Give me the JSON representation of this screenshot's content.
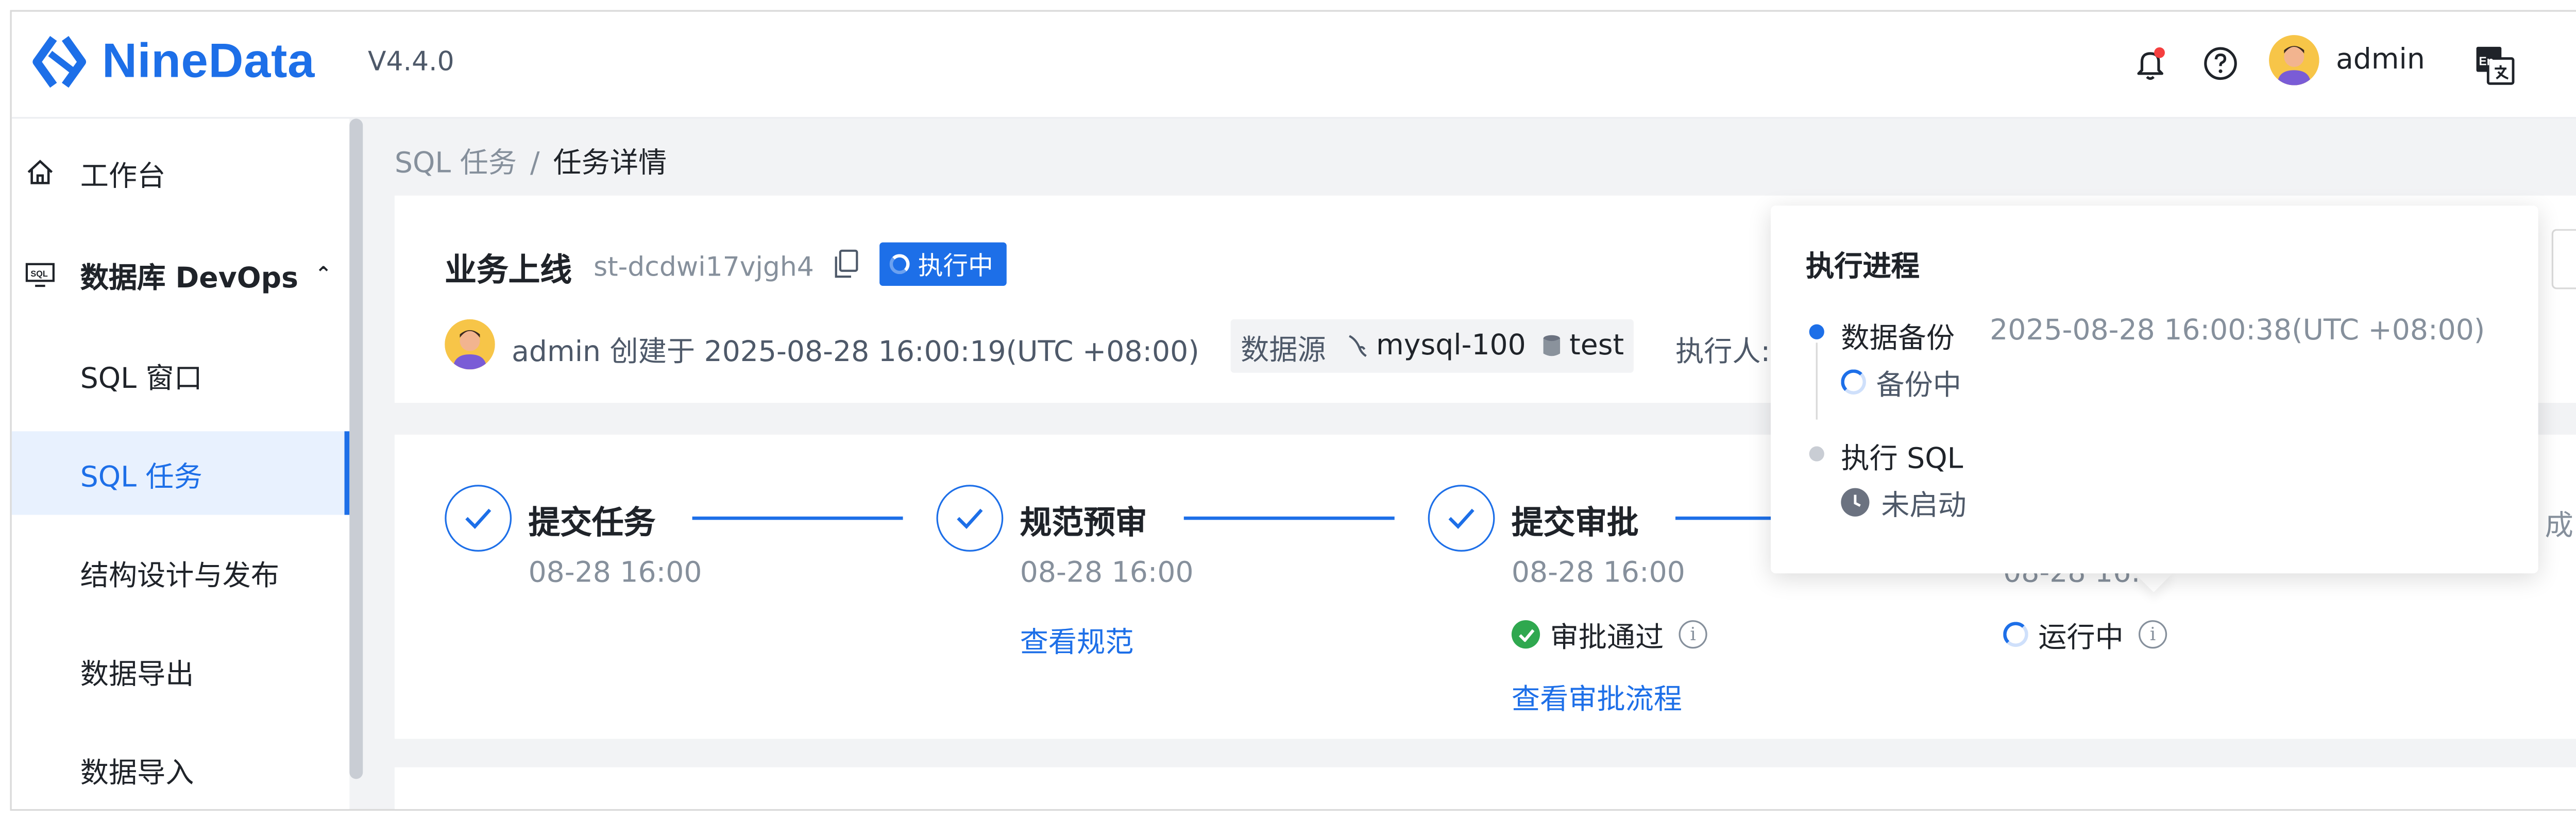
{
  "app": {
    "brand": "NineData",
    "version": "V4.4.0"
  },
  "header": {
    "username": "admin",
    "icons": [
      "bell-icon",
      "help-icon",
      "language-switch-icon"
    ],
    "lang_badge": "En"
  },
  "sidebar": {
    "items": [
      {
        "label": "工作台",
        "icon": "home-icon"
      },
      {
        "label": "数据库 DevOps",
        "icon": "sql-monitor-icon",
        "expanded": true
      },
      {
        "label": "SQL 窗口"
      },
      {
        "label": "SQL 任务",
        "active": true
      },
      {
        "label": "结构设计与发布"
      },
      {
        "label": "数据导出"
      },
      {
        "label": "数据导入"
      }
    ]
  },
  "breadcrumb": {
    "parent": "SQL 任务",
    "separator": "/",
    "current": "任务详情"
  },
  "task": {
    "title": "业务上线",
    "id": "st-dcdwi17vjgh4",
    "status": "执行中",
    "creator": "admin 创建于 2025-08-28 16:00:19(UTC +08:00)",
    "datasource_label": "数据源",
    "datasource": "mysql-100",
    "database": "test",
    "executor_label": "执行人:"
  },
  "steps": [
    {
      "title": "提交任务",
      "time": "08-28 16:00"
    },
    {
      "title": "规范预审",
      "time": "08-28 16:00",
      "link": "查看规范"
    },
    {
      "title": "提交审批",
      "time": "08-28 16:00",
      "approval": "审批通过",
      "link": "查看审批流程"
    },
    {
      "time_partial": "08-28 16:",
      "status": "运行中"
    }
  ],
  "step_tail": "成",
  "popover": {
    "title": "执行进程",
    "items": [
      {
        "name": "数据备份",
        "time": "2025-08-28 16:00:38(UTC +08:00)",
        "status": "备份中",
        "state": "running"
      },
      {
        "name": "执行 SQL",
        "status": "未启动",
        "state": "pending"
      }
    ]
  },
  "colors": {
    "primary": "#1d6fe8",
    "success": "#2fa84f",
    "muted": "#86909c"
  }
}
